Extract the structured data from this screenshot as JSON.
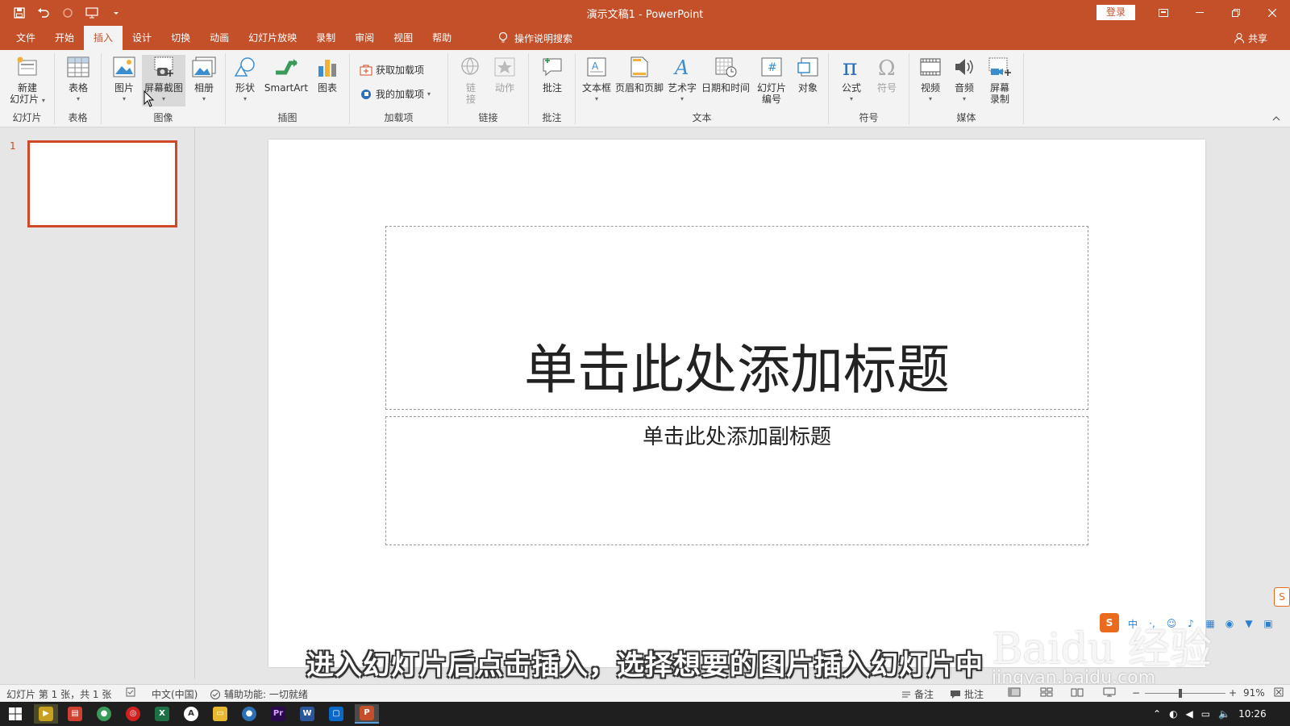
{
  "window": {
    "title": "演示文稿1  -  PowerPoint",
    "login": "登录"
  },
  "menu": {
    "tabs": [
      "文件",
      "开始",
      "插入",
      "设计",
      "切换",
      "动画",
      "幻灯片放映",
      "录制",
      "审阅",
      "视图",
      "帮助"
    ],
    "active_tab": "插入",
    "tell_me": "操作说明搜索",
    "share": "共享"
  },
  "ribbon": {
    "groups": {
      "slides": "幻灯片",
      "tables": "表格",
      "images": "图像",
      "illustrations": "插图",
      "addins": "加载项",
      "links": "链接",
      "comments": "批注",
      "text": "文本",
      "symbols": "符号",
      "media": "媒体"
    },
    "buttons": {
      "new_slide_1": "新建",
      "new_slide_2": "幻灯片",
      "table": "表格",
      "picture": "图片",
      "screenshot": "屏幕截图",
      "album": "相册",
      "shapes": "形状",
      "smartart": "SmartArt",
      "chart": "图表",
      "get_addins": "获取加载项",
      "my_addins": "我的加载项",
      "link_1": "链",
      "link_2": "接",
      "action": "动作",
      "comment": "批注",
      "textbox": "文本框",
      "header_footer": "页眉和页脚",
      "wordart": "艺术字",
      "datetime": "日期和时间",
      "slide_number_1": "幻灯片",
      "slide_number_2": "编号",
      "object": "对象",
      "equation": "公式",
      "symbol": "符号",
      "video": "视频",
      "audio": "音频",
      "screen_record_1": "屏幕",
      "screen_record_2": "录制"
    }
  },
  "thumbs": {
    "number": "1"
  },
  "slide": {
    "title_placeholder": "单击此处添加标题",
    "subtitle_placeholder": "单击此处添加副标题"
  },
  "caption": "进入幻灯片后点击插入，选择想要的图片插入幻灯片中",
  "watermark": {
    "text": "Baidu 经验",
    "url": "jingyan.baidu.com"
  },
  "status": {
    "slide_info": "幻灯片 第 1 张，共 1 张",
    "language": "中文(中国)",
    "accessibility": "辅助功能: 一切就绪",
    "notes": "备注",
    "comments": "批注",
    "zoom": "91%"
  },
  "taskbar": {
    "time": "10:26"
  },
  "colors": {
    "accent": "#c4502a",
    "thumb_border": "#d24726"
  }
}
